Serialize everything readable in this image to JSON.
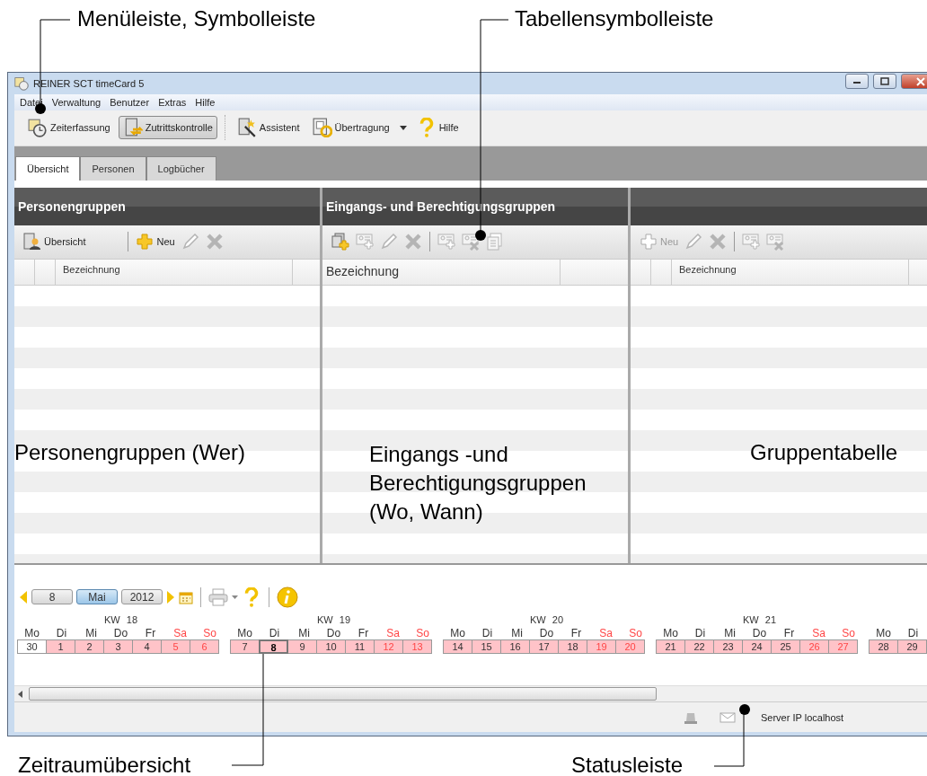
{
  "annotations": [
    {
      "text": "Menüleiste, Symbolleiste"
    },
    {
      "text": "Tabellensymbolleiste"
    },
    {
      "text": "Zeitraumübersicht"
    },
    {
      "text": "Statusleiste"
    }
  ],
  "window": {
    "title": "REINER SCT timeCard 5"
  },
  "menu": [
    "Datei",
    "Verwaltung",
    "Benutzer",
    "Extras",
    "Hilfe"
  ],
  "toolbar": [
    {
      "buttons": [
        {
          "kind": "clock",
          "label": "Zeiterfassung",
          "selected": false,
          "menu": false
        },
        {
          "kind": "door",
          "label": "Zutrittskontrolle",
          "selected": true,
          "menu": false
        }
      ]
    },
    {
      "buttons": [
        {
          "kind": "wizard",
          "label": "Assistent",
          "selected": false,
          "menu": false
        },
        {
          "kind": "transfer",
          "label": "Übertragung",
          "selected": false,
          "menu": true
        },
        {
          "kind": "help",
          "label": "Hilfe",
          "selected": false,
          "menu": false
        }
      ]
    }
  ],
  "tabs": [
    {
      "label": "Übersicht",
      "selected": true
    },
    {
      "label": "Personen",
      "selected": false
    },
    {
      "label": "Logbücher",
      "selected": false
    }
  ],
  "panels": [
    {
      "title": "Personengruppen",
      "row_markers": true,
      "column": "Bezeichnung",
      "caption": "Personengruppen (Wer)",
      "tools": [
        [
          {
            "kind": "overview",
            "label": "Übersicht",
            "disabled": false
          }
        ],
        [
          {
            "kind": "add",
            "label": "Neu",
            "disabled": false
          },
          {
            "kind": "edit",
            "disabled": true
          },
          {
            "kind": "delete",
            "disabled": true
          }
        ]
      ]
    },
    {
      "title": "Eingangs- und Berechtigungsgruppen",
      "row_markers": false,
      "column": "Bezeichnung",
      "caption": "Eingangs -und Berechtigungsgruppen (Wo, Wann)",
      "tools": [
        [
          {
            "kind": "add-doc",
            "disabled": false
          },
          {
            "kind": "card-add",
            "disabled": true
          },
          {
            "kind": "edit",
            "disabled": true
          },
          {
            "kind": "delete",
            "disabled": true
          }
        ],
        [
          {
            "kind": "card-add",
            "disabled": true
          },
          {
            "kind": "card-delete",
            "disabled": true
          },
          {
            "kind": "copy",
            "disabled": true
          }
        ]
      ]
    },
    {
      "row_markers": true,
      "column": "Bezeichnung",
      "caption": "Gruppentabelle",
      "tools": [
        [
          {
            "kind": "add",
            "label": "Neu",
            "disabled": true
          },
          {
            "kind": "edit",
            "disabled": true
          },
          {
            "kind": "delete",
            "disabled": true
          }
        ],
        [
          {
            "kind": "card-add",
            "disabled": true
          },
          {
            "kind": "card-delete",
            "disabled": true
          }
        ]
      ]
    }
  ],
  "calendar": {
    "fields": [
      {
        "text": "8",
        "selected": false
      },
      {
        "text": "Mai",
        "selected": true
      },
      {
        "text": "2012",
        "selected": false
      }
    ],
    "weeks": [
      {
        "label": "KW 18",
        "days": [
          {
            "dow": "Mo",
            "date": "30",
            "in_range": false,
            "weekend": false,
            "selected": false
          },
          {
            "dow": "Di",
            "date": "1",
            "in_range": true,
            "weekend": false,
            "selected": false
          },
          {
            "dow": "Mi",
            "date": "2",
            "in_range": true,
            "weekend": false,
            "selected": false
          },
          {
            "dow": "Do",
            "date": "3",
            "in_range": true,
            "weekend": false,
            "selected": false
          },
          {
            "dow": "Fr",
            "date": "4",
            "in_range": true,
            "weekend": false,
            "selected": false
          },
          {
            "dow": "Sa",
            "date": "5",
            "in_range": true,
            "weekend": true,
            "selected": false
          },
          {
            "dow": "So",
            "date": "6",
            "in_range": true,
            "weekend": true,
            "selected": false
          }
        ]
      },
      {
        "label": "KW 19",
        "days": [
          {
            "dow": "Mo",
            "date": "7",
            "in_range": true,
            "weekend": false,
            "selected": false
          },
          {
            "dow": "Di",
            "date": "8",
            "in_range": true,
            "weekend": false,
            "selected": true
          },
          {
            "dow": "Mi",
            "date": "9",
            "in_range": true,
            "weekend": false,
            "selected": false
          },
          {
            "dow": "Do",
            "date": "10",
            "in_range": true,
            "weekend": false,
            "selected": false
          },
          {
            "dow": "Fr",
            "date": "11",
            "in_range": true,
            "weekend": false,
            "selected": false
          },
          {
            "dow": "Sa",
            "date": "12",
            "in_range": true,
            "weekend": true,
            "selected": false
          },
          {
            "dow": "So",
            "date": "13",
            "in_range": true,
            "weekend": true,
            "selected": false
          }
        ]
      },
      {
        "label": "KW 20",
        "days": [
          {
            "dow": "Mo",
            "date": "14",
            "in_range": true,
            "weekend": false,
            "selected": false
          },
          {
            "dow": "Di",
            "date": "15",
            "in_range": true,
            "weekend": false,
            "selected": false
          },
          {
            "dow": "Mi",
            "date": "16",
            "in_range": true,
            "weekend": false,
            "selected": false
          },
          {
            "dow": "Do",
            "date": "17",
            "in_range": true,
            "weekend": false,
            "selected": false
          },
          {
            "dow": "Fr",
            "date": "18",
            "in_range": true,
            "weekend": false,
            "selected": false
          },
          {
            "dow": "Sa",
            "date": "19",
            "in_range": true,
            "weekend": true,
            "selected": false
          },
          {
            "dow": "So",
            "date": "20",
            "in_range": true,
            "weekend": true,
            "selected": false
          }
        ]
      },
      {
        "label": "KW 21",
        "days": [
          {
            "dow": "Mo",
            "date": "21",
            "in_range": true,
            "weekend": false,
            "selected": false
          },
          {
            "dow": "Di",
            "date": "22",
            "in_range": true,
            "weekend": false,
            "selected": false
          },
          {
            "dow": "Mi",
            "date": "23",
            "in_range": true,
            "weekend": false,
            "selected": false
          },
          {
            "dow": "Do",
            "date": "24",
            "in_range": true,
            "weekend": false,
            "selected": false
          },
          {
            "dow": "Fr",
            "date": "25",
            "in_range": true,
            "weekend": false,
            "selected": false
          },
          {
            "dow": "Sa",
            "date": "26",
            "in_range": true,
            "weekend": true,
            "selected": false
          },
          {
            "dow": "So",
            "date": "27",
            "in_range": true,
            "weekend": true,
            "selected": false
          }
        ]
      },
      {
        "days": [
          {
            "dow": "Mo",
            "date": "28",
            "in_range": true,
            "weekend": false,
            "selected": false
          },
          {
            "dow": "Di",
            "date": "29",
            "in_range": true,
            "weekend": false,
            "selected": false
          }
        ]
      }
    ]
  },
  "status_bar": {
    "server": "Server IP localhost"
  }
}
